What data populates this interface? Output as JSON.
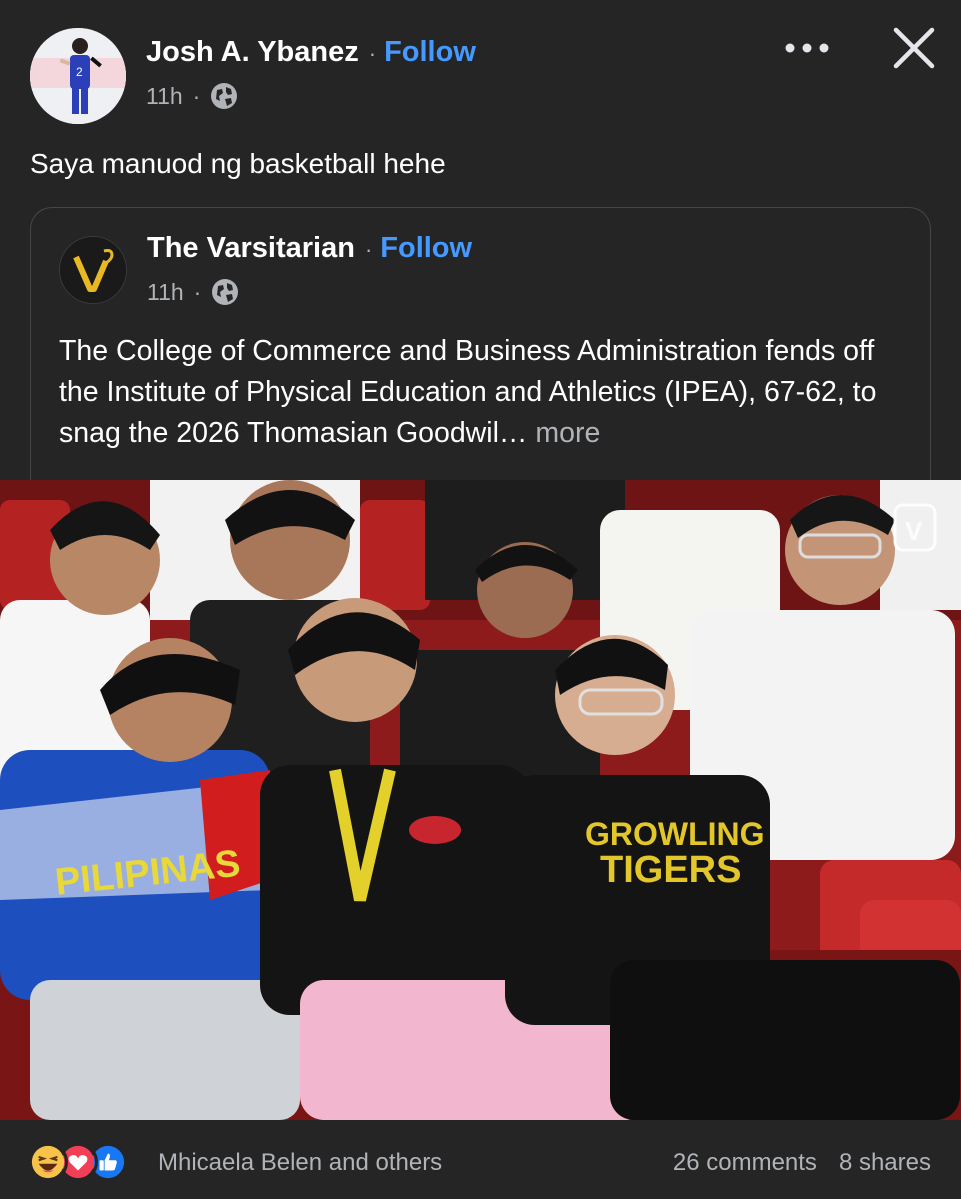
{
  "post": {
    "author": "Josh A. Ybanez",
    "separator": "·",
    "follow_label": "Follow",
    "time": "11h",
    "caption": "Saya manuod ng basketball hehe",
    "avatar_icon": "profile-photo",
    "audience_icon": "globe-icon"
  },
  "shared": {
    "page_name": "The Varsitarian",
    "separator": "·",
    "follow_label": "Follow",
    "time": "11h",
    "text": "The College of Commerce and Business Administration fends off the Institute of Physical Education and Athletics (IPEA), 67-62, to snag the 2026 Thomasian Goodwil…",
    "more_label": " more",
    "logo_text": "V"
  },
  "photo": {
    "description_icon": "group-photo",
    "watermark": "V",
    "shirt_text_1": "PILIPINAS",
    "shirt_text_2a": "GROWLING",
    "shirt_text_2b": "TIGERS"
  },
  "footer": {
    "reactions": [
      "haha",
      "love",
      "like"
    ],
    "reactors": "Mhicaela Belen and others",
    "comments": "26 comments",
    "shares": "8 shares"
  },
  "colors": {
    "background": "#252525",
    "link": "#4599ff",
    "muted": "#b0b3b8"
  }
}
